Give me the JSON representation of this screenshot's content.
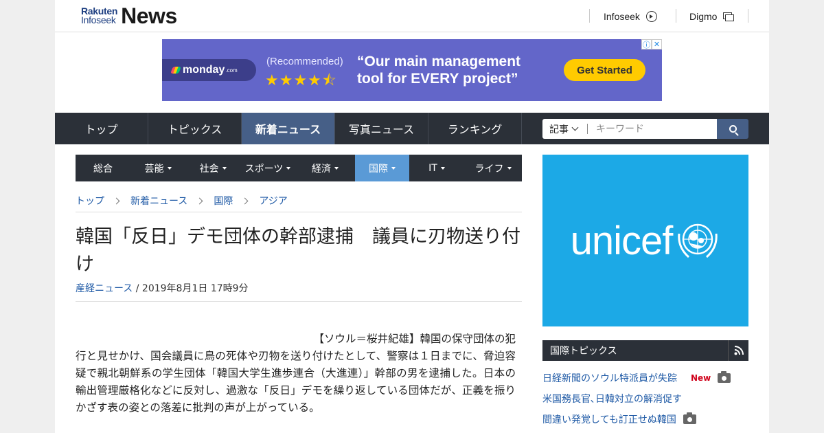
{
  "header": {
    "logo_small_1": "Rakuten",
    "logo_small_2": "Infoseek",
    "logo_big": "News",
    "links": [
      {
        "label": "Infoseek",
        "icon": "arrow-circle-icon"
      },
      {
        "label": "Digmo",
        "icon": "window-icon"
      }
    ]
  },
  "ad": {
    "brand": "monday",
    "brand_suffix": ".com",
    "recommended": "(Recommended)",
    "stars": "★★★★⯪",
    "rating": 4.5,
    "headline_1": "“Our main management",
    "headline_2": "tool for EVERY project”",
    "cta": "Get Started",
    "accent": "#6366c9",
    "cta_color": "#ffcb00"
  },
  "main_nav": {
    "items": [
      "トップ",
      "トピックス",
      "新着ニュース",
      "写真ニュース",
      "ランキング"
    ],
    "active": "新着ニュース"
  },
  "search": {
    "select_value": "記事",
    "placeholder": "キーワード"
  },
  "sub_nav": {
    "items": [
      {
        "label": "総合",
        "dropdown": false
      },
      {
        "label": "芸能",
        "dropdown": true
      },
      {
        "label": "社会",
        "dropdown": true
      },
      {
        "label": "スポーツ",
        "dropdown": true
      },
      {
        "label": "経済",
        "dropdown": true
      },
      {
        "label": "国際",
        "dropdown": true
      },
      {
        "label": "IT",
        "dropdown": true
      },
      {
        "label": "ライフ",
        "dropdown": true
      }
    ],
    "active": "国際"
  },
  "breadcrumb": [
    "トップ",
    "新着ニュース",
    "国際",
    "アジア"
  ],
  "article": {
    "title": "韓国「反日」デモ団体の幹部逮捕　議員に刃物送り付け",
    "source": "産経ニュース",
    "date": " / 2019年8月1日 17時9分",
    "lead": "【ソウル＝桜井紀雄】韓国の保守団体の犯",
    "body": "行と見せかけ、国会議員に鳥の死体や刃物を送り付けたとして、警察は１日までに、脅迫容疑で親北朝鮮系の学生団体「韓国大学生進歩連合（大進連）」幹部の男を逮捕した。日本の輸出管理厳格化などに反対し、過激な「反日」デモを繰り返している団体だが、正義を振りかざす表の姿との落差に批判の声が上がっている。"
  },
  "sidebar": {
    "banner_text": "unicef",
    "banner_color": "#1ca9e6",
    "topics_header": "国際トピックス",
    "topics": [
      {
        "label": "日経新聞のソウル特派員が失踪",
        "badge": "New",
        "camera": true
      },
      {
        "label": "米国務長官､日韓対立の解消促す",
        "badge": "",
        "camera": false
      },
      {
        "label": "間違い発覚しても訂正せぬ韓国",
        "badge": "",
        "camera": true
      }
    ]
  }
}
